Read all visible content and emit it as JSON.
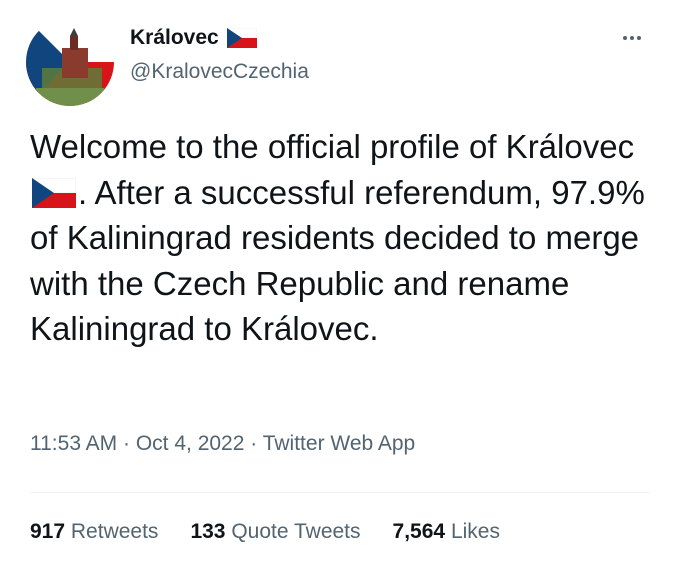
{
  "profile": {
    "display_name": "Královec",
    "handle": "@KralovecCzechia",
    "flag_icon": "czech-flag-icon"
  },
  "tweet": {
    "text_part1": "Welcome to the official profile of Královec",
    "text_part2": ". After a successful referendum, 97.9% of Kaliningrad residents decided to merge with the Czech Republic and rename Kaliningrad to Královec."
  },
  "meta": {
    "time": "11:53 AM",
    "sep1": " · ",
    "date": "Oct 4, 2022",
    "sep2": " · ",
    "source": "Twitter Web App"
  },
  "stats": {
    "retweets_count": "917",
    "retweets_label": "Retweets",
    "quotes_count": "133",
    "quotes_label": "Quote Tweets",
    "likes_count": "7,564",
    "likes_label": "Likes"
  },
  "colors": {
    "flag_blue": "#11457e",
    "flag_red": "#d7141a",
    "secondary_text": "#536471"
  }
}
